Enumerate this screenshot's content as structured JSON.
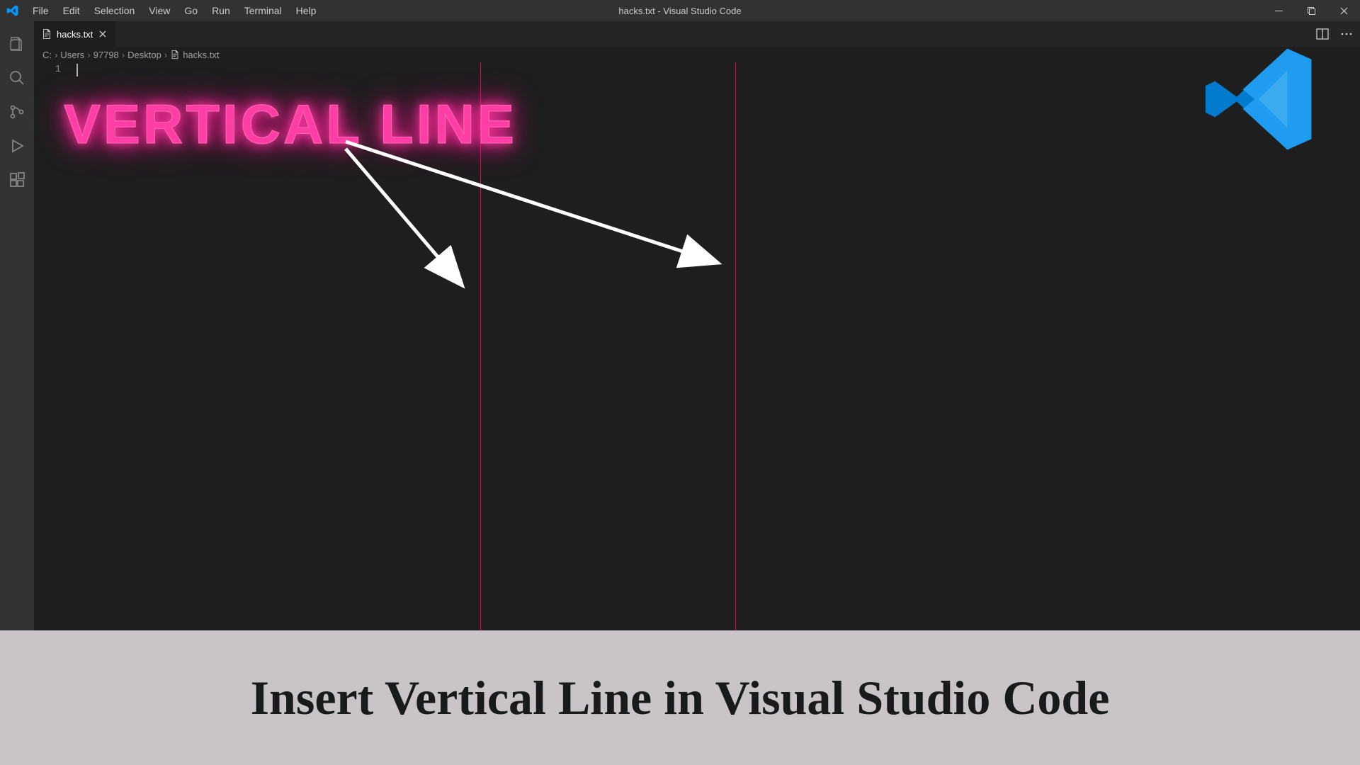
{
  "window": {
    "title": "hacks.txt - Visual Studio Code"
  },
  "menu": {
    "file": "File",
    "edit": "Edit",
    "selection": "Selection",
    "view": "View",
    "go": "Go",
    "run": "Run",
    "terminal": "Terminal",
    "help": "Help"
  },
  "tab": {
    "name": "hacks.txt"
  },
  "breadcrumb": {
    "c": "C:",
    "users": "Users",
    "user": "97798",
    "desktop": "Desktop",
    "file": "hacks.txt"
  },
  "editor": {
    "line1": "1"
  },
  "overlay": {
    "heading": "VERTICAL LINE"
  },
  "caption": {
    "text": "Insert Vertical Line in Visual Studio Code"
  }
}
